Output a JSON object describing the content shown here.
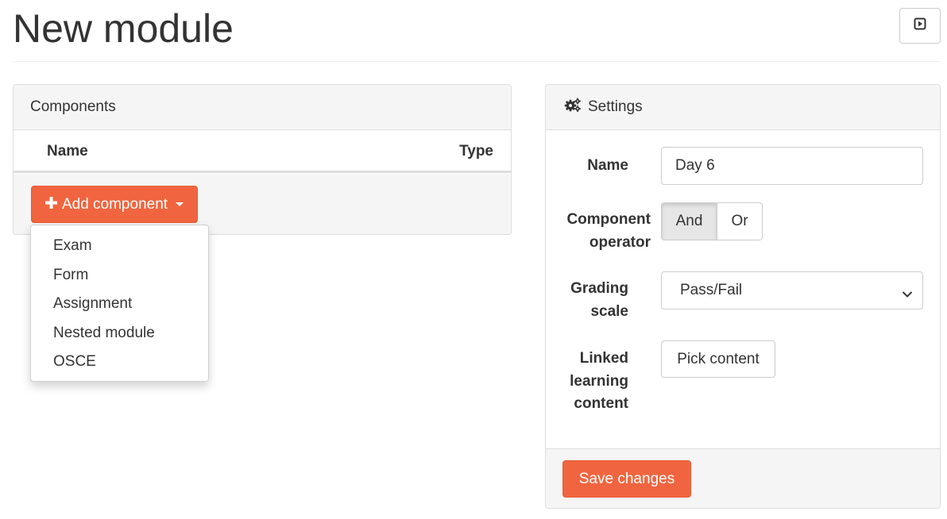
{
  "page": {
    "title": "New module"
  },
  "header": {
    "present_icon": "present-icon"
  },
  "components": {
    "heading": "Components",
    "columns": {
      "name": "Name",
      "type": "Type"
    },
    "add_button": {
      "icon": "plus-icon",
      "label": "Add component"
    },
    "dropdown_items": [
      "Exam",
      "Form",
      "Assignment",
      "Nested module",
      "OSCE"
    ]
  },
  "settings": {
    "heading_icon": "cogs-icon",
    "heading": "Settings",
    "name_label": "Name",
    "name_value": "Day 6",
    "operator_label_line1": "Component",
    "operator_label_line2": "operator",
    "operator_options": {
      "and": "And",
      "or": "Or"
    },
    "operator_selected": "And",
    "grading_label_line1": "Grading",
    "grading_label_line2": "scale",
    "grading_value": "Pass/Fail",
    "linked_label_line1": "Linked",
    "linked_label_line2": "learning",
    "linked_label_line3": "content",
    "pick_button": "Pick content",
    "save_button": "Save changes"
  },
  "colors": {
    "accent": "#f0653f",
    "panel_heading_bg": "#f5f5f5",
    "border": "#dddddd"
  }
}
